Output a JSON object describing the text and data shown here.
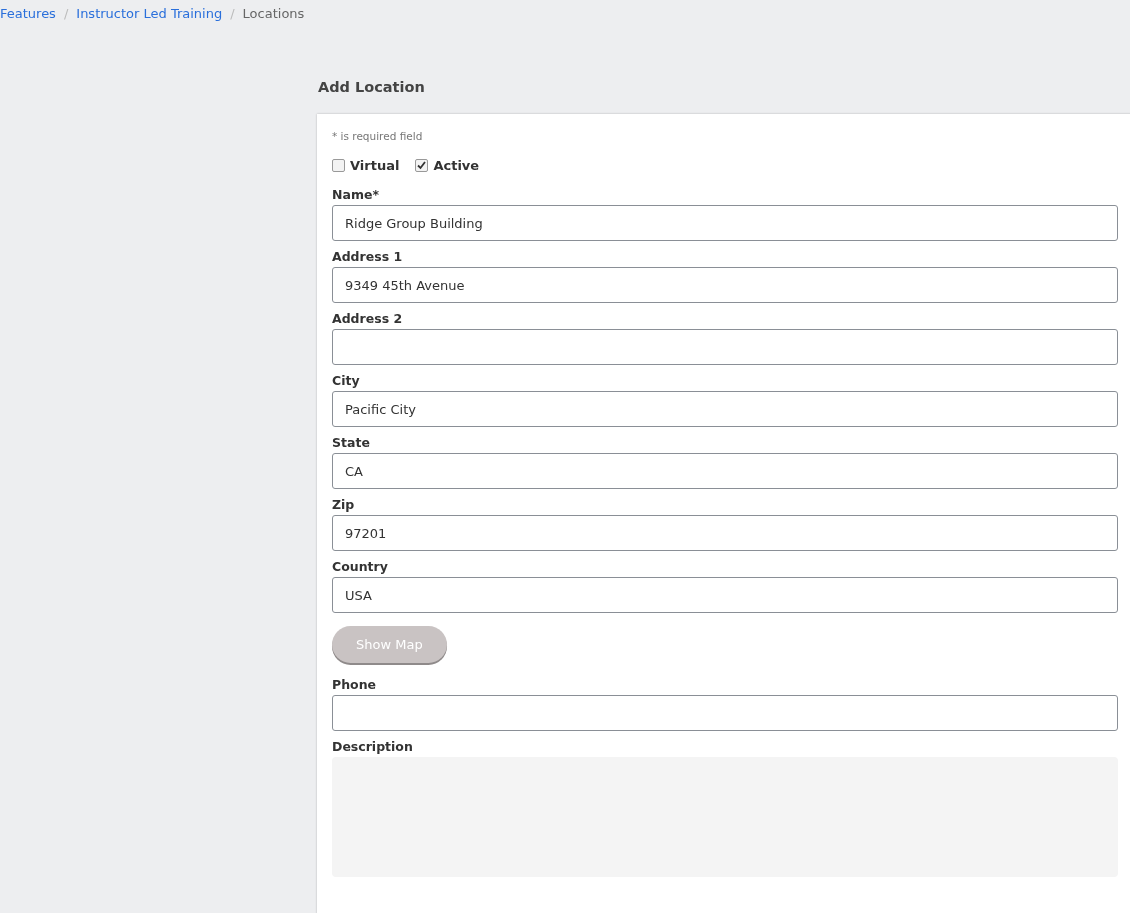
{
  "breadcrumb": [
    {
      "label": "Features",
      "link": true
    },
    {
      "label": "Instructor Led Training",
      "link": true
    },
    {
      "label": "Locations",
      "link": false
    }
  ],
  "breadcrumb_separator": "/",
  "title": "Add Location",
  "required_note": "* is required field",
  "checkboxes": [
    {
      "label": "Virtual",
      "checked": false
    },
    {
      "label": "Active",
      "checked": true
    }
  ],
  "fields": [
    {
      "kind": "input",
      "label": "Name*",
      "value": "Ridge Group Building"
    },
    {
      "kind": "input",
      "label": "Address 1",
      "value": "9349 45th Avenue"
    },
    {
      "kind": "input",
      "label": "Address 2"
    },
    {
      "kind": "input",
      "label": "City",
      "value": "Pacific City"
    },
    {
      "kind": "input",
      "label": "State",
      "value": "CA"
    },
    {
      "kind": "input",
      "label": "Zip",
      "value": "97201"
    },
    {
      "kind": "input",
      "label": "Country",
      "value": "USA"
    },
    {
      "kind": "button",
      "label": "Show Map"
    },
    {
      "kind": "input",
      "label": "Phone"
    },
    {
      "kind": "textarea",
      "label": "Description"
    }
  ]
}
